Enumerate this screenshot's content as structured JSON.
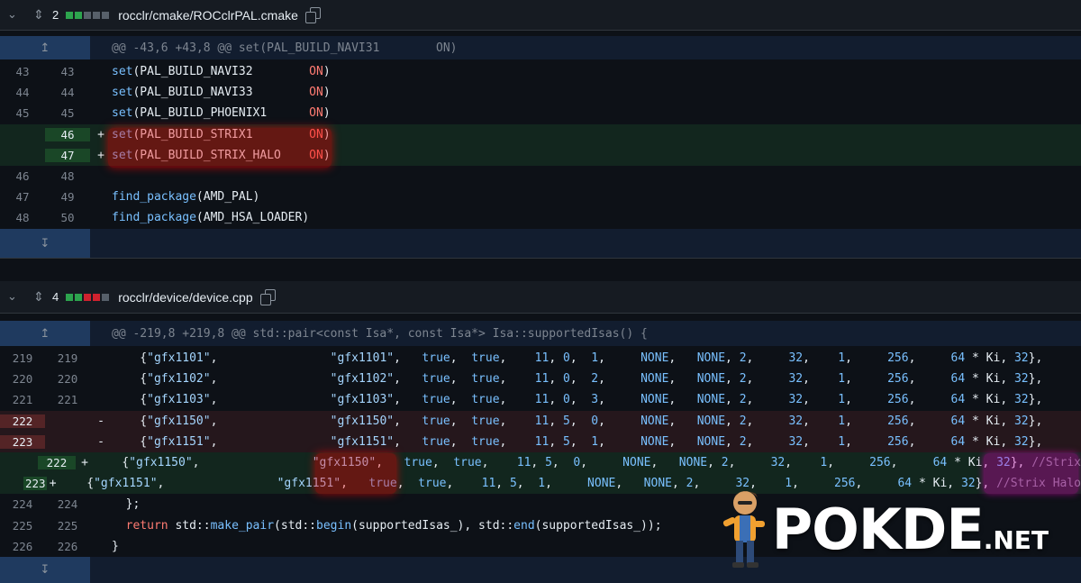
{
  "files": [
    {
      "changes": "2",
      "blocks": [
        "#2da44e",
        "#2da44e",
        "#57606a",
        "#57606a",
        "#57606a"
      ],
      "path": "rocclr/cmake/ROCclrPAL.cmake",
      "hunk": "@@ -43,6 +43,8 @@ set(PAL_BUILD_NAVI31        ON)"
    },
    {
      "changes": "4",
      "blocks": [
        "#2da44e",
        "#2da44e",
        "#cf222e",
        "#cf222e",
        "#57606a"
      ],
      "path": "rocclr/device/device.cpp",
      "hunk": "@@ -219,8 +219,8 @@ std::pair<const Isa*, const Isa*> Isa::supportedIsas() {"
    }
  ],
  "lines1": [
    {
      "type": "ctx",
      "old": "43",
      "new": "43",
      "sign": "",
      "code": "set(PAL_BUILD_NAVI32        ON)"
    },
    {
      "type": "ctx",
      "old": "44",
      "new": "44",
      "sign": "",
      "code": "set(PAL_BUILD_NAVI33        ON)"
    },
    {
      "type": "ctx",
      "old": "45",
      "new": "45",
      "sign": "",
      "code": "set(PAL_BUILD_PHOENIX1      ON)"
    },
    {
      "type": "add",
      "old": "",
      "new": "46",
      "sign": "+",
      "code": "set(PAL_BUILD_STRIX1        ON)"
    },
    {
      "type": "add",
      "old": "",
      "new": "47",
      "sign": "+",
      "code": "set(PAL_BUILD_STRIX_HALO    ON)"
    },
    {
      "type": "ctx",
      "old": "46",
      "new": "48",
      "sign": "",
      "code": ""
    },
    {
      "type": "ctx",
      "old": "47",
      "new": "49",
      "sign": "",
      "code": "find_package(AMD_PAL)"
    },
    {
      "type": "ctx",
      "old": "48",
      "new": "50",
      "sign": "",
      "code": "find_package(AMD_HSA_LOADER)"
    }
  ],
  "lines2": [
    {
      "type": "ctx",
      "old": "219",
      "new": "219",
      "sign": "",
      "code": "    {\"gfx1101\",                \"gfx1101\",   true,  true,    11, 0,  1,     NONE,   NONE, 2,     32,    1,     256,     64 * Ki, 32},"
    },
    {
      "type": "ctx",
      "old": "220",
      "new": "220",
      "sign": "",
      "code": "    {\"gfx1102\",                \"gfx1102\",   true,  true,    11, 0,  2,     NONE,   NONE, 2,     32,    1,     256,     64 * Ki, 32},"
    },
    {
      "type": "ctx",
      "old": "221",
      "new": "221",
      "sign": "",
      "code": "    {\"gfx1103\",                \"gfx1103\",   true,  true,    11, 0,  3,     NONE,   NONE, 2,     32,    1,     256,     64 * Ki, 32},"
    },
    {
      "type": "del",
      "old": "222",
      "new": "",
      "sign": "-",
      "code": "    {\"gfx1150\",                \"gfx1150\",   true,  true,    11, 5,  0,     NONE,   NONE, 2,     32,    1,     256,     64 * Ki, 32},"
    },
    {
      "type": "del",
      "old": "223",
      "new": "",
      "sign": "-",
      "code": "    {\"gfx1151\",                \"gfx1151\",   true,  true,    11, 5,  1,     NONE,   NONE, 2,     32,    1,     256,     64 * Ki, 32},"
    },
    {
      "type": "add",
      "old": "",
      "new": "222",
      "sign": "+",
      "code": "    {\"gfx1150\",                \"gfx1150\",   true,  true,    11, 5,  0,     NONE,   NONE, 2,     32,    1,     256,     64 * Ki, 32}, //Strix"
    },
    {
      "type": "add",
      "old": "",
      "new": "223",
      "sign": "+",
      "code": "    {\"gfx1151\",                \"gfx1151\",   true,  true,    11, 5,  1,     NONE,   NONE, 2,     32,    1,     256,     64 * Ki, 32}, //Strix Halo"
    },
    {
      "type": "ctx",
      "old": "224",
      "new": "224",
      "sign": "",
      "code": "  };"
    },
    {
      "type": "ctx",
      "old": "225",
      "new": "225",
      "sign": "",
      "code": "  return std::make_pair(std::begin(supportedIsas_), std::end(supportedIsas_));"
    },
    {
      "type": "ctx",
      "old": "226",
      "new": "226",
      "sign": "",
      "code": "}"
    }
  ],
  "watermark": "POKDE",
  "watermark_suffix": ".NET",
  "icons": {
    "collapse": "chevron-down-icon",
    "expand": "unfold-icon",
    "copy": "copy-icon",
    "expand_up": "expand-up-icon",
    "expand_down": "expand-down-icon"
  }
}
